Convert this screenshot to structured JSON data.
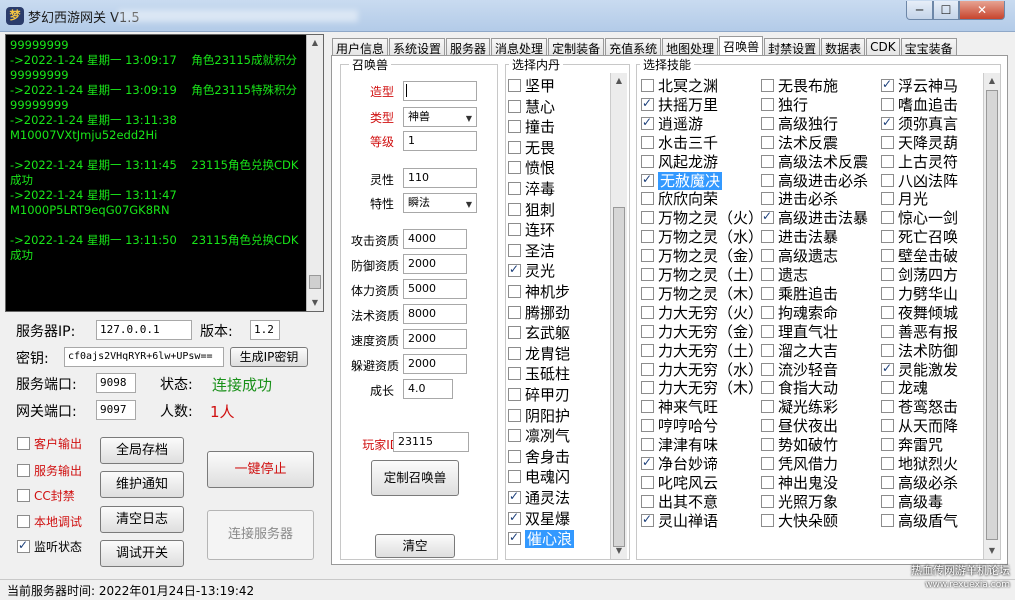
{
  "window": {
    "title": "梦幻西游网关 V1.5",
    "icon": "game-logo-icon",
    "min": "─",
    "max": "☐",
    "close": "✕"
  },
  "log": {
    "lines": [
      "99999999",
      "->2022-1-24 星期一 13:09:17    角色23115成就积分",
      "99999999",
      "->2022-1-24 星期一 13:09:19    角色23115特殊积分",
      "99999999",
      "->2022-1-24 星期一 13:11:38",
      "M10007VXtJmju52edd2Hi",
      "",
      "->2022-1-24 星期一 13:11:45    23115角色兑换CDK",
      "成功",
      "->2022-1-24 星期一 13:11:47",
      "M1000P5LRT9eqG07GK8RN",
      "",
      "->2022-1-24 星期一 13:11:50    23115角色兑换CDK",
      "成功"
    ]
  },
  "server": {
    "ip_label": "服务器IP:",
    "ip_value": "127.0.0.1",
    "ver_label": "版本:",
    "ver_value": "1.2",
    "key_label": "密钥:",
    "key_value": "cf0ajs2VHqRYR+6lw+UPsw==",
    "gen_key_btn": "生成IP密钥",
    "sport_label": "服务端口:",
    "sport_value": "9098",
    "status_label": "状态:",
    "status_value": "连接成功",
    "gport_label": "网关端口:",
    "gport_value": "9097",
    "people_label": "人数:",
    "people_value": "1人"
  },
  "options": [
    {
      "label": "客户输出",
      "checked": false,
      "red": true
    },
    {
      "label": "服务输出",
      "checked": false,
      "red": true
    },
    {
      "label": "CC封禁",
      "checked": false,
      "red": true
    },
    {
      "label": "本地调试",
      "checked": false,
      "red": true
    },
    {
      "label": "监听状态",
      "checked": true,
      "red": false
    }
  ],
  "buttons": {
    "save_all": "全局存档",
    "maintain": "维护通知",
    "clear_log": "清空日志",
    "debug": "调试开关",
    "stop": "一键停止",
    "connect": "连接服务器"
  },
  "tabs": [
    "用户信息",
    "系统设置",
    "服务器",
    "消息处理",
    "定制装备",
    "充值系统",
    "地图处理",
    "召唤兽",
    "封禁设置",
    "数据表",
    "CDK",
    "宝宝装备"
  ],
  "summon": {
    "group_title": "召唤兽",
    "model_label": "造型",
    "model_value": "",
    "type_label": "类型",
    "type_value": "神兽",
    "level_label": "等级",
    "level_value": "1",
    "spirit_label": "灵性",
    "spirit_value": "110",
    "trait_label": "特性",
    "trait_value": "瞬法",
    "atk_label": "攻击资质",
    "atk_value": "4000",
    "def_label": "防御资质",
    "def_value": "2000",
    "hp_label": "体力资质",
    "hp_value": "5000",
    "mag_label": "法术资质",
    "mag_value": "8000",
    "spd_label": "速度资质",
    "spd_value": "2000",
    "dodge_label": "躲避资质",
    "dodge_value": "2000",
    "growth_label": "成长",
    "growth_value": "4.0",
    "player_label": "玩家ID",
    "player_value": "23115",
    "custom_btn": "定制召唤兽",
    "clear_btn": "清空"
  },
  "neidan": {
    "title": "选择内丹",
    "items": [
      {
        "t": "坚甲",
        "c": false
      },
      {
        "t": "慧心",
        "c": false
      },
      {
        "t": "撞击",
        "c": false
      },
      {
        "t": "无畏",
        "c": false
      },
      {
        "t": "愤恨",
        "c": false
      },
      {
        "t": "淬毒",
        "c": false
      },
      {
        "t": "狙刺",
        "c": false
      },
      {
        "t": "连环",
        "c": false
      },
      {
        "t": "圣洁",
        "c": false
      },
      {
        "t": "灵光",
        "c": true
      },
      {
        "t": "神机步",
        "c": false
      },
      {
        "t": "腾挪劲",
        "c": false
      },
      {
        "t": "玄武躯",
        "c": false
      },
      {
        "t": "龙胄铠",
        "c": false
      },
      {
        "t": "玉砥柱",
        "c": false
      },
      {
        "t": "碎甲刃",
        "c": false
      },
      {
        "t": "阴阳护",
        "c": false
      },
      {
        "t": "凛冽气",
        "c": false
      },
      {
        "t": "舍身击",
        "c": false
      },
      {
        "t": "电魂闪",
        "c": false
      },
      {
        "t": "通灵法",
        "c": true
      },
      {
        "t": "双星爆",
        "c": true
      },
      {
        "t": "催心浪",
        "c": true,
        "hl": true
      }
    ]
  },
  "skills": {
    "title": "选择技能",
    "col1": [
      {
        "t": "北冥之渊",
        "c": false
      },
      {
        "t": "扶摇万里",
        "c": true
      },
      {
        "t": "逍遥游",
        "c": true
      },
      {
        "t": "水击三千",
        "c": false
      },
      {
        "t": "风起龙游",
        "c": false
      },
      {
        "t": "无赦魔决",
        "c": true,
        "hl": true
      },
      {
        "t": "欣欣向荣",
        "c": false
      },
      {
        "t": "万物之灵（火）",
        "c": false
      },
      {
        "t": "万物之灵（水）",
        "c": false
      },
      {
        "t": "万物之灵（金）",
        "c": false
      },
      {
        "t": "万物之灵（土）",
        "c": false
      },
      {
        "t": "万物之灵（木）",
        "c": false
      },
      {
        "t": "力大无穷（火）",
        "c": false
      },
      {
        "t": "力大无穷（金）",
        "c": false
      },
      {
        "t": "力大无穷（土）",
        "c": false
      },
      {
        "t": "力大无穷（水）",
        "c": false
      },
      {
        "t": "力大无穷（木）",
        "c": false
      },
      {
        "t": "神来气旺",
        "c": false
      },
      {
        "t": "哼哼哈兮",
        "c": false
      },
      {
        "t": "津津有味",
        "c": false
      },
      {
        "t": "净台妙谛",
        "c": true
      },
      {
        "t": "叱咤风云",
        "c": false
      },
      {
        "t": "出其不意",
        "c": false
      },
      {
        "t": "灵山禅语",
        "c": true
      }
    ],
    "col2": [
      {
        "t": "无畏布施",
        "c": false
      },
      {
        "t": "独行",
        "c": false
      },
      {
        "t": "高级独行",
        "c": false
      },
      {
        "t": "法术反震",
        "c": false
      },
      {
        "t": "高级法术反震",
        "c": false
      },
      {
        "t": "高级进击必杀",
        "c": false
      },
      {
        "t": "进击必杀",
        "c": false
      },
      {
        "t": "高级进击法暴",
        "c": true
      },
      {
        "t": "进击法暴",
        "c": false
      },
      {
        "t": "高级遗志",
        "c": false
      },
      {
        "t": "遗志",
        "c": false
      },
      {
        "t": "乘胜追击",
        "c": false
      },
      {
        "t": "拘魂索命",
        "c": false
      },
      {
        "t": "理直气壮",
        "c": false
      },
      {
        "t": "溜之大吉",
        "c": false
      },
      {
        "t": "流沙轻音",
        "c": false
      },
      {
        "t": "食指大动",
        "c": false
      },
      {
        "t": "凝光练彩",
        "c": false
      },
      {
        "t": "昼伏夜出",
        "c": false
      },
      {
        "t": "势如破竹",
        "c": false
      },
      {
        "t": "凭风借力",
        "c": false
      },
      {
        "t": "神出鬼没",
        "c": false
      },
      {
        "t": "光照万象",
        "c": false
      },
      {
        "t": "大快朵颐",
        "c": false
      }
    ],
    "col3": [
      {
        "t": "浮云神马",
        "c": true
      },
      {
        "t": "嗜血追击",
        "c": false
      },
      {
        "t": "须弥真言",
        "c": true
      },
      {
        "t": "天降灵葫",
        "c": false
      },
      {
        "t": "上古灵符",
        "c": false
      },
      {
        "t": "八凶法阵",
        "c": false
      },
      {
        "t": "月光",
        "c": false
      },
      {
        "t": "惊心一剑",
        "c": false
      },
      {
        "t": "死亡召唤",
        "c": false
      },
      {
        "t": "壁垒击破",
        "c": false
      },
      {
        "t": "剑荡四方",
        "c": false
      },
      {
        "t": "力劈华山",
        "c": false
      },
      {
        "t": "夜舞倾城",
        "c": false
      },
      {
        "t": "善恶有报",
        "c": false
      },
      {
        "t": "法术防御",
        "c": false
      },
      {
        "t": "灵能激发",
        "c": true
      },
      {
        "t": "龙魂",
        "c": false
      },
      {
        "t": "苍鸾怒击",
        "c": false
      },
      {
        "t": "从天而降",
        "c": false
      },
      {
        "t": "奔雷咒",
        "c": false
      },
      {
        "t": "地狱烈火",
        "c": false
      },
      {
        "t": "高级必杀",
        "c": false
      },
      {
        "t": "高级毒",
        "c": false
      },
      {
        "t": "高级盾气",
        "c": false
      }
    ]
  },
  "statusbar": {
    "text": "当前服务器时间:   2022年01月24日-13:19:42"
  },
  "watermark": {
    "line1": "热血传网游单机论坛",
    "line2": "www.rexuexia.com"
  }
}
